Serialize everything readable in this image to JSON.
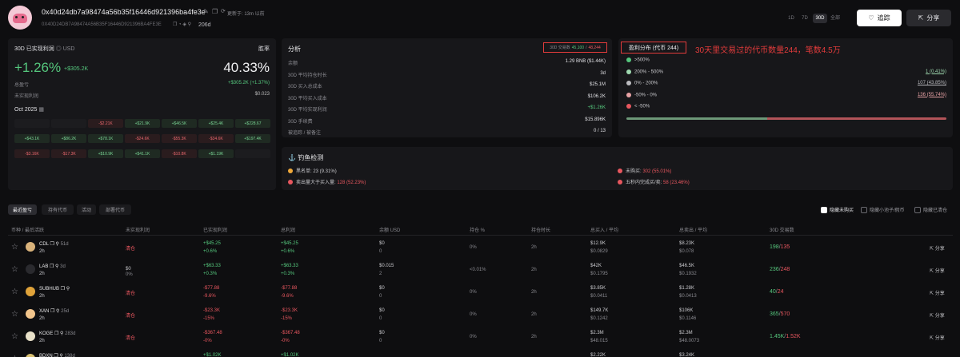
{
  "header": {
    "address": "0x40d24db7a98474a56b35f16446d921396ba4fe3e",
    "updated": "更新于: 13m 以前",
    "address_upper": "0X40D24DB7A98474A56B35F16446D921396BA4FE3E",
    "age": "206d",
    "ranges": [
      "1D",
      "7D",
      "30D",
      "全部"
    ],
    "follow": "追踪",
    "share": "分享"
  },
  "pnl": {
    "title": "30D 已实现利润",
    "unit": "USD",
    "winrate_label": "胜率",
    "pct": "+1.26%",
    "amount": "+$305.2K",
    "winrate": "40.33%",
    "total_label": "总盈亏",
    "total_value": "+$305.2K (+1.37%)",
    "unreal_label": "未实现利润",
    "unreal_value": "$0.023",
    "month": "Oct 2025"
  },
  "calendar": [
    [
      "",
      "",
      "-$2.21K",
      "+$21.9K",
      "+$46.5K",
      "+$25.4K",
      "+$228.67"
    ],
    [
      "+$43.1K",
      "+$86.2K",
      "+$78.1K",
      "-$24.6K",
      "-$55.3K",
      "-$34.6K",
      "+$197.4K"
    ],
    [
      "-$3.16K",
      "-$17.3K",
      "+$10.9K",
      "+$41.1K",
      "-$10.8K",
      "+$1.19K",
      ""
    ]
  ],
  "analysis": {
    "title": "分析",
    "tx_label": "30D 交易数",
    "tx_buy": "45,100",
    "tx_sell": "48,244",
    "rows": [
      {
        "label": "余额",
        "value": "1.29 BNB ($1.44K)"
      },
      {
        "label": "30D 平均持仓时长",
        "value": "3d"
      },
      {
        "label": "30D 买入总成本",
        "value": "$25.1M"
      },
      {
        "label": "30D 平均买入成本",
        "value": "$106.2K"
      },
      {
        "label": "30D 平均实现利润",
        "value": "+$1.26K"
      },
      {
        "label": "30D 手续费",
        "value": "$15.896K"
      },
      {
        "label": "被追踪 / 被备注",
        "value": "0 / 13"
      }
    ]
  },
  "distribution": {
    "title": "盈利分布 (代币 244)",
    "annotation": "30天里交易过的代币数量244，笔数4.5万",
    "rows": [
      {
        "label": ">500%",
        "value": "",
        "color": "#55c77d"
      },
      {
        "label": "200% - 500%",
        "value": "1 (0.41%)",
        "color": "#9fd9b0"
      },
      {
        "label": "0% - 200%",
        "value": "107 (43.85%)",
        "color": "#bcbcc0"
      },
      {
        "label": "-50% - 0%",
        "value": "136 (55.74%)",
        "color": "#e8a2a5"
      },
      {
        "label": "< -50%",
        "value": "",
        "color": "#e8575f"
      }
    ],
    "bar": {
      "green_share": 0.44,
      "red_share": 0.56
    }
  },
  "phishing": {
    "title": "钓鱼检测",
    "items": [
      {
        "label": "黑名单:",
        "value": "23 (9.31%)",
        "color": "#f0a93a"
      },
      {
        "label": "未购买:",
        "value": "302 (55.01%)",
        "color": "#e8575f"
      },
      {
        "label": "卖出量大于买入量:",
        "value": "128 (52.23%)",
        "color": "#e8575f"
      },
      {
        "label": "五秒内完成买/卖:",
        "value": "58 (23.46%)",
        "color": "#e8575f"
      }
    ]
  },
  "tabs": [
    "最近盈亏",
    "持有代币",
    "活动",
    "部署代币"
  ],
  "filters": [
    "隐藏未购买",
    "隐藏小池子/假币",
    "隐藏已清仓"
  ],
  "columns": [
    "币种 / 最后活跃",
    "未实现利润",
    "已实现利润",
    "总利润",
    "余额 USD",
    "持仓 %",
    "持仓时长",
    "总买入 / 平均",
    "总卖出 / 平均",
    "30D 交易数"
  ],
  "rows": [
    {
      "sym": "CDL",
      "age": "51d",
      "t": "2h",
      "unreal": "清仓",
      "real": "+$45.25",
      "real_pct": "+0.6%",
      "total": "+$45.25",
      "total_pct": "+0.6%",
      "bal": "$0",
      "bal2": "0",
      "pos": "0%",
      "hold": "2h",
      "buy": "$12.9K",
      "buy_avg": "$0.0829",
      "sell": "$8.23K",
      "sell_avg": "$0.078",
      "tx_a": "198",
      "tx_b": "135",
      "share": "分享",
      "coin_color": "#d9b27a"
    },
    {
      "sym": "LAB",
      "age": "3d",
      "t": "2h",
      "unreal": "$0",
      "unreal2": "0%",
      "real": "+$63.33",
      "real_pct": "+0.3%",
      "total": "+$63.33",
      "total_pct": "+0.3%",
      "bal": "$0.015",
      "bal2": "2",
      "pos": "<0.01%",
      "hold": "2h",
      "buy": "$42K",
      "buy_avg": "$0.1795",
      "sell": "$46.5K",
      "sell_avg": "$0.1932",
      "tx_a": "236",
      "tx_b": "248",
      "share": "分享",
      "coin_color": "#2a2a2e"
    },
    {
      "sym": "SUBHUB",
      "age": "",
      "t": "2h",
      "unreal": "清仓",
      "real": "-$77.88",
      "real_pct": "-9.6%",
      "total": "-$77.88",
      "total_pct": "-9.6%",
      "bal": "$0",
      "bal2": "0",
      "pos": "0%",
      "hold": "2h",
      "buy": "$3.85K",
      "buy_avg": "$0.0411",
      "sell": "$1.28K",
      "sell_avg": "$0.0413",
      "tx_a": "40",
      "tx_b": "24",
      "share": "分享",
      "coin_color": "#e0a33a"
    },
    {
      "sym": "XAN",
      "age": "25d",
      "t": "2h",
      "unreal": "清仓",
      "real": "-$23.3K",
      "real_pct": "-15%",
      "total": "-$23.3K",
      "total_pct": "-15%",
      "bal": "$0",
      "bal2": "0",
      "pos": "0%",
      "hold": "2h",
      "buy": "$149.7K",
      "buy_avg": "$0.1242",
      "sell": "$106K",
      "sell_avg": "$0.1146",
      "tx_a": "365",
      "tx_b": "570",
      "share": "分享",
      "coin_color": "#f2c58c"
    },
    {
      "sym": "KOGE",
      "age": "283d",
      "t": "2h",
      "unreal": "清仓",
      "real": "-$367.48",
      "real_pct": "-0%",
      "total": "-$367.48",
      "total_pct": "-0%",
      "bal": "$0",
      "bal2": "0",
      "pos": "0%",
      "hold": "2h",
      "buy": "$2.3M",
      "buy_avg": "$48.015",
      "sell": "$2.3M",
      "sell_avg": "$48.0073",
      "tx_a": "1.45K",
      "tx_b": "1.52K",
      "share": "分享",
      "coin_color": "#e8e0c8"
    },
    {
      "sym": "BDXN",
      "age": "138d",
      "t": "",
      "unreal": "",
      "real": "+$1.02K",
      "real_pct": "",
      "total": "+$1.02K",
      "total_pct": "",
      "bal": "",
      "bal2": "",
      "pos": "",
      "hold": "",
      "buy": "$2.22K",
      "buy_avg": "",
      "sell": "$3.24K",
      "sell_avg": "",
      "tx_a": "",
      "tx_b": "",
      "share": "",
      "coin_color": "#d9c070"
    }
  ]
}
